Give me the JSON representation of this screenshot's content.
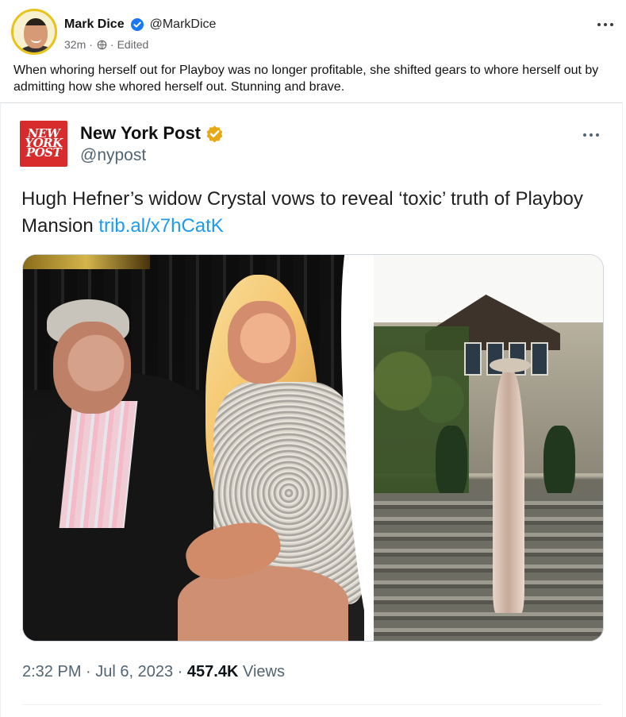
{
  "post": {
    "author_name": "Mark Dice",
    "author_handle": "@MarkDice",
    "time": "32m",
    "separator": "·",
    "edited": "Edited",
    "text": "When whoring herself out for Playboy was no longer profitable, she shifted gears to whore herself out by admitting how she whored herself out. Stunning and brave."
  },
  "embedded_tweet": {
    "logo_text": "NEW YORK POST",
    "author_name": "New York Post",
    "author_handle": "@nypost",
    "text": "Hugh Hefner’s widow Crystal vows to reveal ‘toxic’ truth of Playboy Mansion ",
    "link": "trib.al/x7hCatK",
    "time": "2:32 PM",
    "date_separator": " · ",
    "date": "Jul 6, 2023",
    "views_separator": " · ",
    "views_count": "457.4K",
    "views_label": "Views"
  },
  "icons": {
    "verified": "verified-badge-icon",
    "globe": "globe-icon",
    "more": "more-options-icon",
    "gold_verified": "gold-verified-badge-icon"
  },
  "colors": {
    "facebook_blue": "#1877f2",
    "twitter_link": "#1d9bf0",
    "nyp_red": "#d82b2b",
    "gold_badge": "#e6a817"
  }
}
